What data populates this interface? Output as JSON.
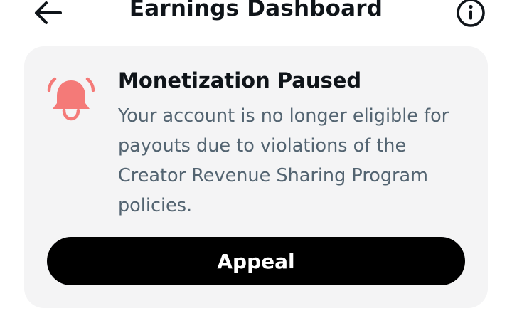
{
  "header": {
    "title": "Earnings Dashboard",
    "back_icon": "arrow-left-icon",
    "info_icon": "info-circle-icon"
  },
  "notice": {
    "icon": "bell-ringing-icon",
    "icon_color": "#f47a78",
    "title": "Monetization Paused",
    "body": "Your account is no longer eligible for payouts due to violations of the Creator Revenue Sharing Program policies."
  },
  "actions": {
    "appeal_label": "Appeal"
  },
  "colors": {
    "card_background": "#f4f4f5",
    "primary_button": "#000000",
    "body_text": "#536471",
    "title_text": "#0f1419"
  }
}
